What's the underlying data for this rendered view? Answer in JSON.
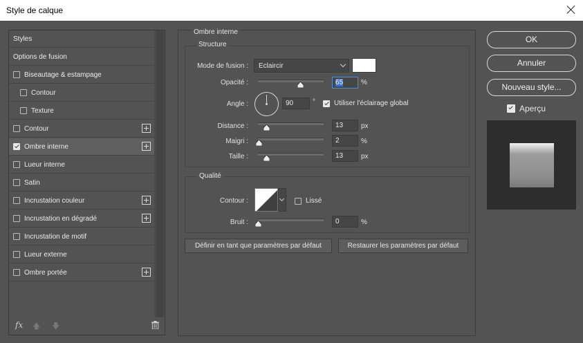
{
  "window": {
    "title": "Style de calque"
  },
  "sidebar": {
    "items": [
      {
        "label": "Styles",
        "checkbox": false,
        "checked": false,
        "indent": 0,
        "plus": false,
        "selected": false
      },
      {
        "label": "Options de fusion",
        "checkbox": false,
        "checked": false,
        "indent": 0,
        "plus": false,
        "selected": false
      },
      {
        "label": "Biseautage & estampage",
        "checkbox": true,
        "checked": false,
        "indent": 0,
        "plus": false,
        "selected": false
      },
      {
        "label": "Contour",
        "checkbox": true,
        "checked": false,
        "indent": 1,
        "plus": false,
        "selected": false
      },
      {
        "label": "Texture",
        "checkbox": true,
        "checked": false,
        "indent": 1,
        "plus": false,
        "selected": false
      },
      {
        "label": "Contour",
        "checkbox": true,
        "checked": false,
        "indent": 0,
        "plus": true,
        "selected": false
      },
      {
        "label": "Ombre interne",
        "checkbox": true,
        "checked": true,
        "indent": 0,
        "plus": true,
        "selected": true
      },
      {
        "label": "Lueur interne",
        "checkbox": true,
        "checked": false,
        "indent": 0,
        "plus": false,
        "selected": false
      },
      {
        "label": "Satin",
        "checkbox": true,
        "checked": false,
        "indent": 0,
        "plus": false,
        "selected": false
      },
      {
        "label": "Incrustation couleur",
        "checkbox": true,
        "checked": false,
        "indent": 0,
        "plus": true,
        "selected": false
      },
      {
        "label": "Incrustation en dégradé",
        "checkbox": true,
        "checked": false,
        "indent": 0,
        "plus": true,
        "selected": false
      },
      {
        "label": "Incrustation de motif",
        "checkbox": true,
        "checked": false,
        "indent": 0,
        "plus": false,
        "selected": false
      },
      {
        "label": "Lueur externe",
        "checkbox": true,
        "checked": false,
        "indent": 0,
        "plus": false,
        "selected": false
      },
      {
        "label": "Ombre portée",
        "checkbox": true,
        "checked": false,
        "indent": 0,
        "plus": true,
        "selected": false
      }
    ],
    "fx_label": "fx"
  },
  "panel": {
    "title": "Ombre interne",
    "structure": {
      "title": "Structure",
      "blend_mode_label": "Mode de fusion :",
      "blend_mode_value": "Eclaircir",
      "swatch_color": "#ffffff",
      "opacity_label": "Opacité :",
      "opacity_value": "65",
      "opacity_fraction": 0.65,
      "opacity_unit": "%",
      "angle_label": "Angle :",
      "angle_value": "90",
      "angle_unit": "°",
      "global_light_label": "Utiliser l'éclairage global",
      "distance_label": "Distance :",
      "distance_value": "13",
      "distance_fraction": 0.13,
      "distance_unit": "px",
      "choke_label": "Maigri :",
      "choke_value": "2",
      "choke_fraction": 0.02,
      "choke_unit": "%",
      "size_label": "Taille :",
      "size_value": "13",
      "size_fraction": 0.13,
      "size_unit": "px"
    },
    "quality": {
      "title": "Qualité",
      "contour_label": "Contour :",
      "antialias_label": "Lissé",
      "noise_label": "Bruit :",
      "noise_value": "0",
      "noise_fraction": 0,
      "noise_unit": "%"
    },
    "make_default_label": "Définir en tant que paramètres par défaut",
    "reset_default_label": "Restaurer les paramètres par défaut"
  },
  "buttons": {
    "ok": "OK",
    "cancel": "Annuler",
    "new_style": "Nouveau style...",
    "preview_label": "Aperçu"
  }
}
